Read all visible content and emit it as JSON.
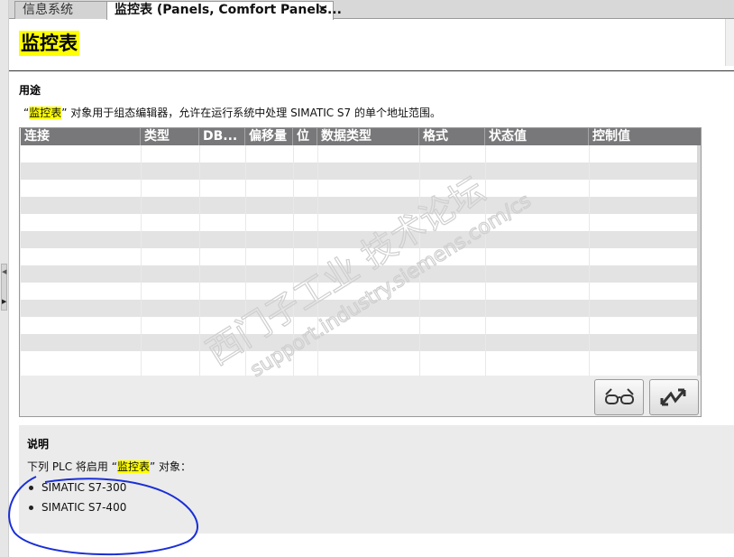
{
  "tabs": [
    {
      "label": "信息系统"
    },
    {
      "label": "监控表 (Panels, Comfort Panels...",
      "close": "✕"
    }
  ],
  "page_title": "监控表",
  "usage": {
    "heading": "用途",
    "quote_open": "“",
    "highlight": "监控表",
    "rest": "” 对象用于组态编辑器，允许在运行系统中处理 SIMATIC S7 的单个地址范围。"
  },
  "table": {
    "columns": [
      "连接",
      "类型",
      "DB...",
      "偏移量",
      "位",
      "数据类型",
      "格式",
      "状态值",
      "控制值"
    ],
    "row_count": 13
  },
  "buttons": [
    {
      "icon": "glasses-icon"
    },
    {
      "icon": "modify-arrows-icon"
    }
  ],
  "note": {
    "heading": "说明",
    "text_before": "下列 PLC 将启用 “",
    "highlight": "监控表",
    "text_after": "” 对象：",
    "items": [
      "SIMATIC S7-300",
      "SIMATIC S7-400"
    ]
  },
  "watermark": {
    "line1": "西门子工业  技术论坛",
    "line2": "support.industry.siemens.com/cs"
  },
  "colors": {
    "highlight": "#ffff00",
    "header": "#78787a",
    "annotation": "#1a2fd6"
  }
}
